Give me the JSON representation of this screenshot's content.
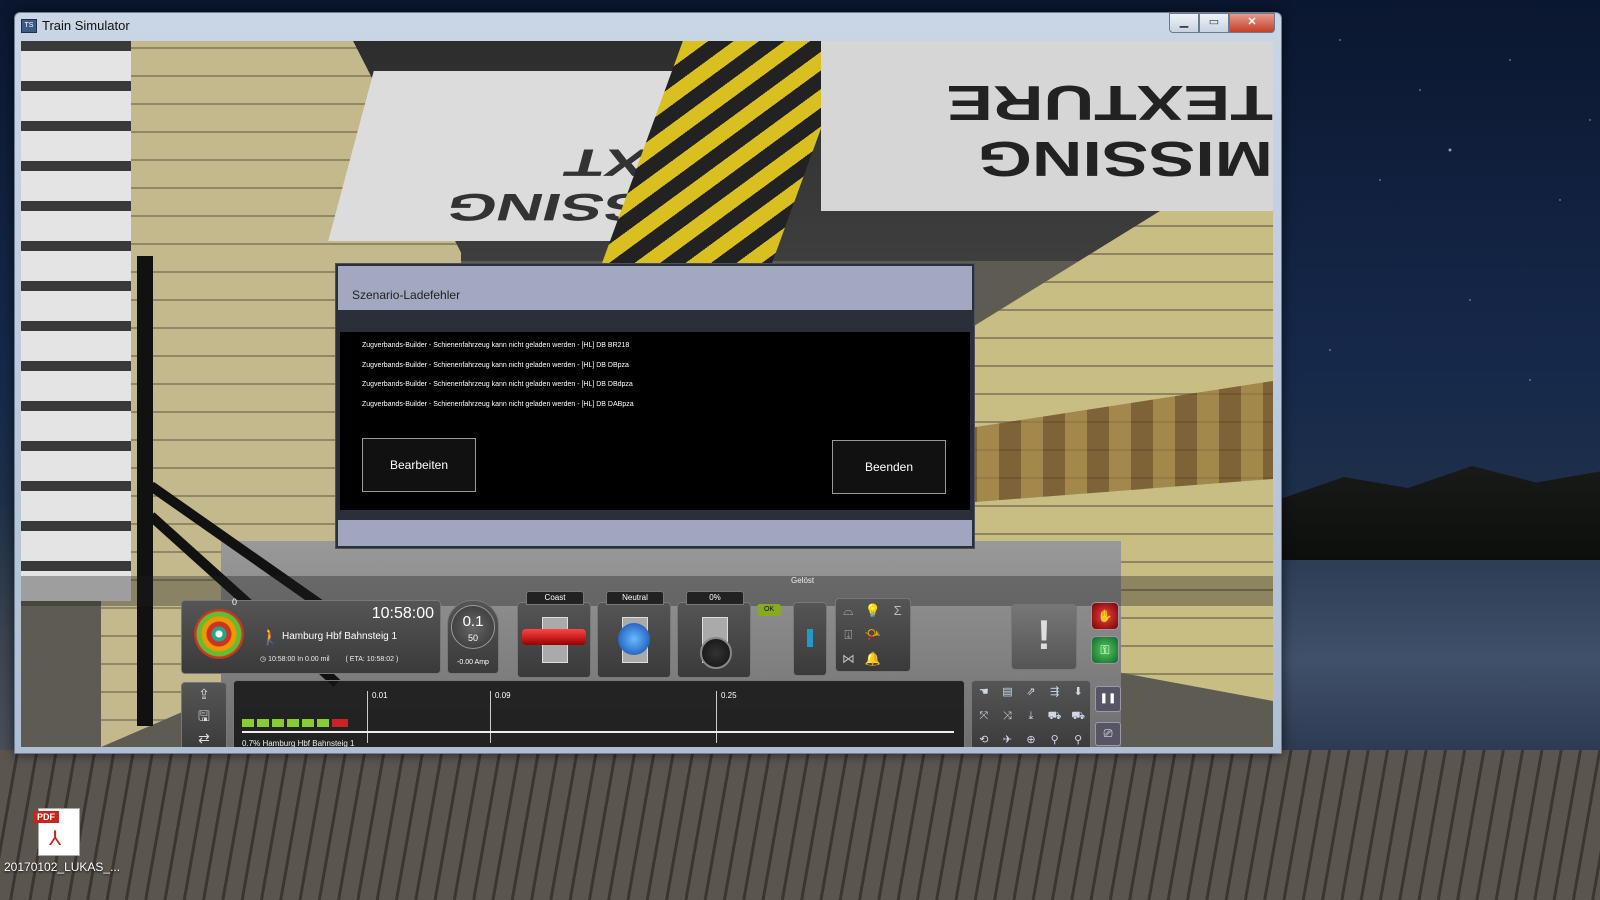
{
  "desktop": {
    "pdf_tag": "PDF",
    "icon_label": "20170102_LUKAS_..."
  },
  "window": {
    "app_icon_text": "TS",
    "title": "Train Simulator",
    "minimize": "▁",
    "maximize": "▭",
    "close": "✕"
  },
  "scene": {
    "sign_left": "MISSING TEXT",
    "sign_right": "MISSING TEXTURE"
  },
  "dialog": {
    "title": "Szenario-Ladefehler",
    "errors": [
      "Zugverbands-Builder - Schienenfahrzeug kann nicht geladen werden - [HL] DB BR218",
      "Zugverbands-Builder - Schienenfahrzeug kann nicht geladen werden - [HL] DB DBpza",
      "Zugverbands-Builder - Schienenfahrzeug kann nicht geladen werden - [HL] DB DBdpza",
      "Zugverbands-Builder - Schienenfahrzeug kann nicht geladen werden - [HL] DB DABpza"
    ],
    "edit_button": "Bearbeiten",
    "quit_button": "Beenden"
  },
  "hud": {
    "signal_count": "0",
    "clock": "10:58:00",
    "destination": "Hamburg Hbf Bahnsteig 1",
    "sched_time": "10:58:00",
    "sched_distance": "In 0.00 mil",
    "eta": "( ETA: 10:58:02 )",
    "speed": "0.1",
    "speed_limit": "50",
    "amperage": "-0.00 Amp",
    "reverser_label": "Coast",
    "throttle_label": "Neutral",
    "brake_label": "0%",
    "aws_label": "OK",
    "gelost_label": "Gelöst",
    "track_distances": [
      "0.01",
      "0.09",
      "0.25"
    ],
    "track_location": "0.7% Hamburg Hbf Bahnsteig 1"
  }
}
